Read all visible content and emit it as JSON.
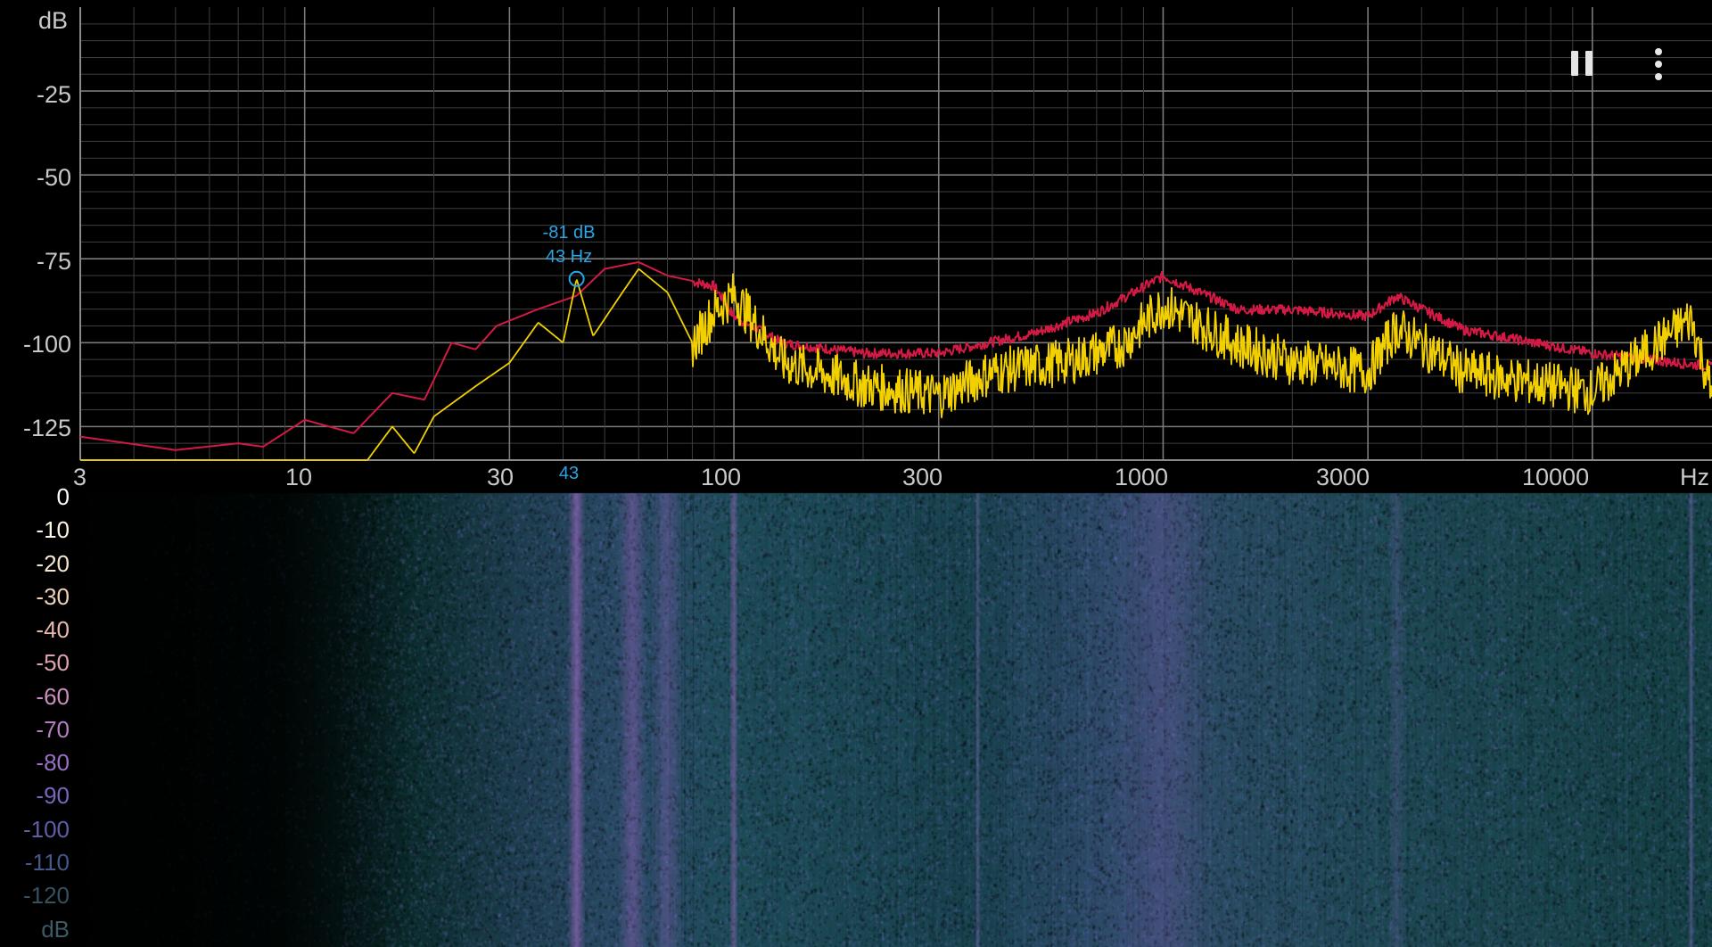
{
  "spectrum": {
    "y_unit": "dB",
    "x_unit": "Hz",
    "y_ticks": [
      "-25",
      "-50",
      "-75",
      "-100",
      "-125"
    ],
    "x_ticks": [
      "3",
      "10",
      "30",
      "100",
      "300",
      "1000",
      "3000",
      "10000"
    ],
    "peak_marker": {
      "db_label": "-81 dB",
      "hz_label": "43 Hz",
      "axis_label": "43",
      "freq_hz": 43,
      "db": -81
    },
    "colors": {
      "grid": "#6e6e6e",
      "peak_hold_line": "#d21a44",
      "live_line": "#f2d000",
      "marker": "#2aa6e6"
    }
  },
  "spectrogram": {
    "scale_unit": "dB",
    "scale_labels": [
      {
        "text": "0",
        "color": "#ffffff"
      },
      {
        "text": "-10",
        "color": "#fbf5e8"
      },
      {
        "text": "-20",
        "color": "#f6e6cd"
      },
      {
        "text": "-30",
        "color": "#efd2b7"
      },
      {
        "text": "-40",
        "color": "#e8b9ae"
      },
      {
        "text": "-50",
        "color": "#dca3b2"
      },
      {
        "text": "-60",
        "color": "#cc8fbd"
      },
      {
        "text": "-70",
        "color": "#b57ec8"
      },
      {
        "text": "-80",
        "color": "#9972c8"
      },
      {
        "text": "-90",
        "color": "#7b66bd"
      },
      {
        "text": "-100",
        "color": "#5f5ea7"
      },
      {
        "text": "-110",
        "color": "#465889"
      },
      {
        "text": "-120",
        "color": "#36505f"
      }
    ],
    "colors": {
      "background": "#0b3a3c",
      "accent": "#a15fc6",
      "low": "#021513"
    }
  },
  "controls": {
    "pause_icon": "pause-icon",
    "menu_icon": "more-vertical-icon"
  },
  "chart_data": {
    "type": "line",
    "title": "",
    "xlabel": "Hz",
    "ylabel": "dB",
    "xscale": "log",
    "xlim": [
      3,
      19000
    ],
    "ylim": [
      -135,
      0
    ],
    "grid": true,
    "x_ticks": [
      3,
      10,
      30,
      100,
      300,
      1000,
      3000,
      10000
    ],
    "y_ticks": [
      -25,
      -50,
      -75,
      -100,
      -125
    ],
    "series": [
      {
        "color": "#d21a44",
        "x": [
          3,
          5,
          7,
          8,
          10,
          13,
          16,
          19,
          22,
          25,
          28,
          35,
          43,
          50,
          60,
          70,
          90,
          100,
          130,
          200,
          300,
          500,
          700,
          1000,
          1500,
          2000,
          3000,
          3500,
          5000,
          10000,
          19000
        ],
        "y": [
          -128,
          -132,
          -130,
          -131,
          -123,
          -127,
          -115,
          -117,
          -100,
          -102,
          -95,
          -90,
          -86,
          -78,
          -76,
          -80,
          -83,
          -92,
          -100,
          -103,
          -103,
          -97,
          -91,
          -80,
          -90,
          -90,
          -92,
          -86,
          -96,
          -103,
          -107
        ]
      },
      {
        "color": "#f2d000",
        "x": [
          3,
          10,
          14,
          16,
          18,
          20,
          25,
          30,
          35,
          40,
          43,
          47,
          55,
          60,
          70,
          80,
          90,
          100,
          130,
          200,
          300,
          400,
          600,
          800,
          1000,
          1500,
          2000,
          3000,
          3500,
          5000,
          10000,
          17000,
          19000
        ],
        "y": [
          -135,
          -135,
          -135,
          -125,
          -133,
          -122,
          -113,
          -106,
          -94,
          -100,
          -81,
          -98,
          -85,
          -78,
          -85,
          -100,
          -90,
          -85,
          -105,
          -112,
          -115,
          -108,
          -105,
          -100,
          -88,
          -100,
          -105,
          -108,
          -95,
          -108,
          -114,
          -92,
          -115
        ]
      }
    ]
  }
}
